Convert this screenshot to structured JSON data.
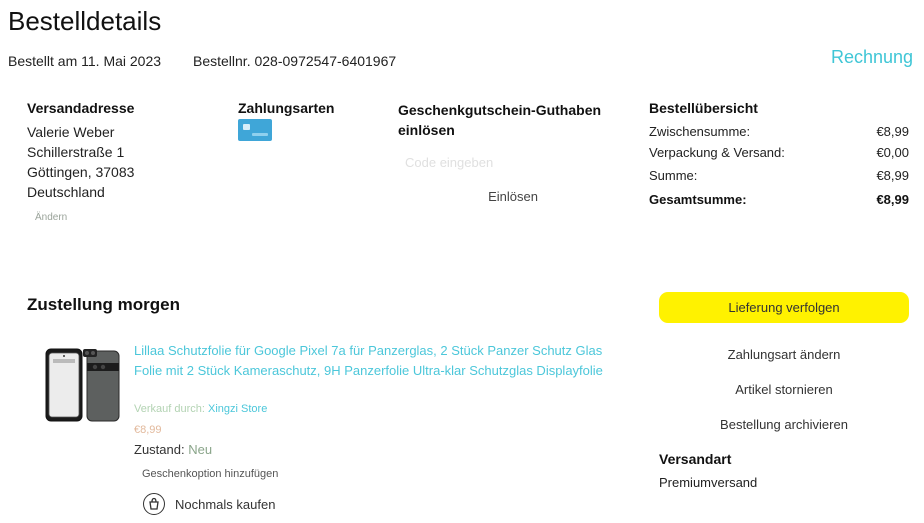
{
  "header": {
    "title": "Bestelldetails",
    "ordered_on": "Bestellt am 11. Mai 2023",
    "order_number": "Bestellnr. 028-0972547-6401967",
    "invoice_link": "Rechnung"
  },
  "shipping_address": {
    "heading": "Versandadresse",
    "lines": [
      "Valerie Weber",
      "Schillerstraße 1",
      "Göttingen, 37083",
      "Deutschland"
    ],
    "change_link": "Ändern"
  },
  "payment": {
    "heading": "Zahlungsarten",
    "card_icon": "credit-card-icon",
    "card_color": "#3fa6d8"
  },
  "gift_card": {
    "heading": "Geschenkgutschein-Guthaben einlösen",
    "placeholder": "Code eingeben",
    "value": "",
    "redeem_button": "Einlösen"
  },
  "summary": {
    "heading": "Bestellübersicht",
    "rows": [
      {
        "label": "Zwischensumme:",
        "value": "€8,99"
      },
      {
        "label": "Verpackung & Versand:",
        "value": "€0,00"
      },
      {
        "label": "Summe:",
        "value": "€8,99"
      },
      {
        "label": "Gesamtsumme:",
        "value": "€8,99"
      }
    ]
  },
  "delivery": {
    "heading": "Zustellung morgen",
    "track_button": "Lieferung verfolgen",
    "track_button_color": "#fff200",
    "actions": [
      "Zahlungsart ändern",
      "Artikel stornieren",
      "Bestellung archivieren"
    ],
    "shipping_method_heading": "Versandart",
    "shipping_method": "Premiumversand"
  },
  "item": {
    "title": "Lillaa Schutzfolie für Google Pixel 7a für Panzerglas, 2 Stück Panzer Schutz Glas Folie mit 2 Stück Kameraschutz, 9H Panzerfolie Ultra-klar Schutzglas Displayfolie",
    "seller_label": "Verkauf durch:",
    "seller_name": "Xingzi Store",
    "price": "€8,99",
    "condition_label": "Zustand:",
    "condition_value": "Neu",
    "gift_option": "Geschenkoption hinzufügen",
    "buy_again": "Nochmals kaufen",
    "link_color": "#4cc7da"
  }
}
